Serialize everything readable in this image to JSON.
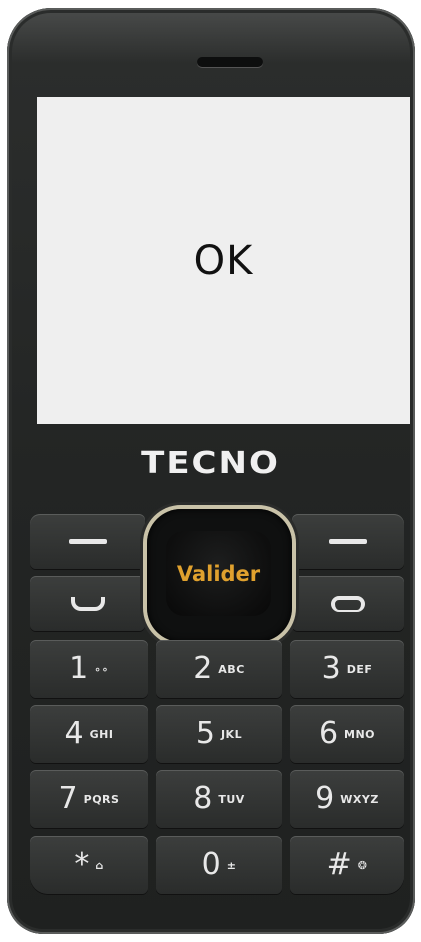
{
  "screen": {
    "text": "OK"
  },
  "brand": "TECNO",
  "nav": {
    "center_label": "Valider"
  },
  "keys": [
    {
      "num": "1",
      "sub": "∘∘"
    },
    {
      "num": "2",
      "sub": "ABC"
    },
    {
      "num": "3",
      "sub": "DEF"
    },
    {
      "num": "4",
      "sub": "GHI"
    },
    {
      "num": "5",
      "sub": "JKL"
    },
    {
      "num": "6",
      "sub": "MNO"
    },
    {
      "num": "7",
      "sub": "PQRS"
    },
    {
      "num": "8",
      "sub": "TUV"
    },
    {
      "num": "9",
      "sub": "WXYZ"
    },
    {
      "num": "*",
      "sub": "⌂"
    },
    {
      "num": "0",
      "sub": "±"
    },
    {
      "num": "#",
      "sub": "❂"
    }
  ],
  "icons": {
    "left_soft": "minus-icon",
    "right_soft": "minus-icon",
    "call": "call-icon",
    "end": "end-call-icon"
  }
}
